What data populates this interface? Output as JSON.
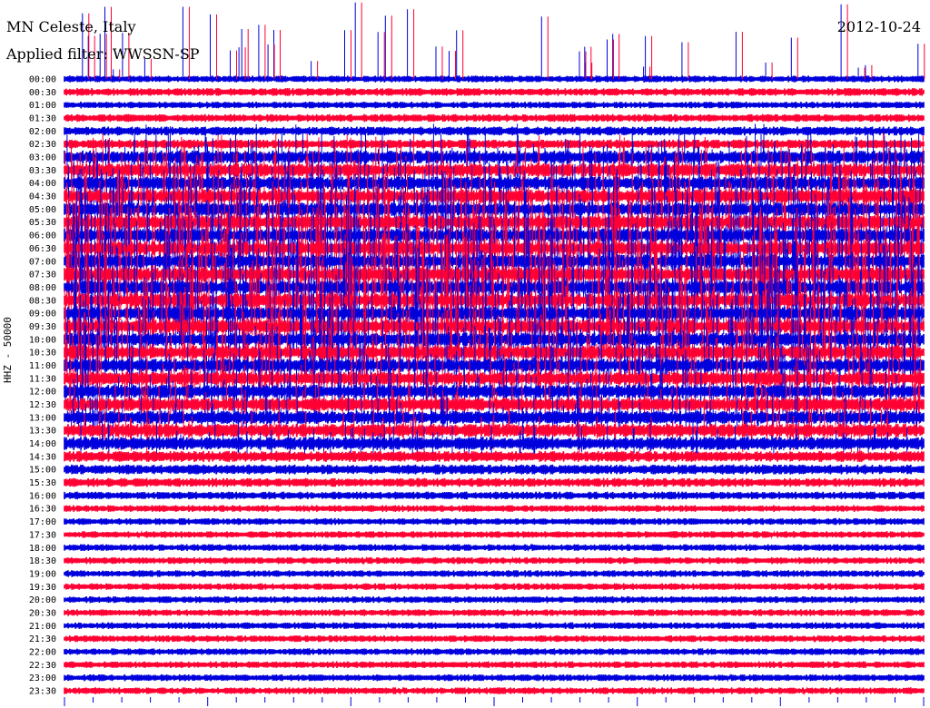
{
  "header": {
    "station": "MN Celeste, Italy",
    "filter": "Applied filter: WWSSN-SP",
    "date": "2012-10-24"
  },
  "chart_data": {
    "type": "line",
    "title": "MN Celeste, Italy",
    "subtitle": "Applied filter: WWSSN-SP",
    "date": "2012-10-24",
    "channel_label": "HHZ - 50000",
    "row_labels": [
      "00:00",
      "00:30",
      "01:00",
      "01:30",
      "02:00",
      "02:30",
      "03:00",
      "03:30",
      "04:00",
      "04:30",
      "05:00",
      "05:30",
      "06:00",
      "06:30",
      "07:00",
      "07:30",
      "08:00",
      "08:30",
      "09:00",
      "09:30",
      "10:00",
      "10:30",
      "11:00",
      "11:30",
      "12:00",
      "12:30",
      "13:00",
      "13:30",
      "14:00",
      "14:30",
      "15:00",
      "15:30",
      "16:00",
      "16:30",
      "17:00",
      "17:30",
      "18:00",
      "18:30",
      "19:00",
      "19:30",
      "20:00",
      "20:30",
      "21:00",
      "21:30",
      "22:00",
      "22:30",
      "23:00",
      "23:30"
    ],
    "row_colors": [
      "#0000dd",
      "#ff0033"
    ],
    "relative_amplitude": [
      0.6,
      0.7,
      0.6,
      0.7,
      0.8,
      0.8,
      1.6,
      1.8,
      2.0,
      2.2,
      2.4,
      2.6,
      2.8,
      3.0,
      3.0,
      3.2,
      3.2,
      3.2,
      3.0,
      3.0,
      2.8,
      2.6,
      2.4,
      2.2,
      2.0,
      1.8,
      1.6,
      1.4,
      1.2,
      1.0,
      0.9,
      0.8,
      0.7,
      0.6,
      0.6,
      0.6,
      0.6,
      0.6,
      0.6,
      0.6,
      0.6,
      0.6,
      0.6,
      0.6,
      0.6,
      0.6,
      0.6,
      0.6
    ]
  }
}
